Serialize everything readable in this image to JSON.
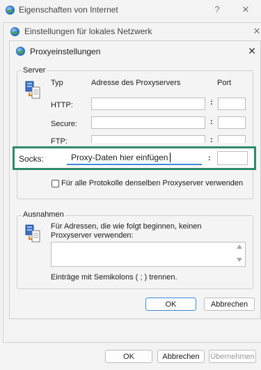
{
  "outer_window": {
    "title": "Eigenschaften von Internet",
    "help": "?",
    "close": "✕"
  },
  "lan_window": {
    "title": "Einstellungen für lokales Netzwerk",
    "close": "✕"
  },
  "proxy_dialog": {
    "title": "Proxyeinstellungen",
    "close": "✕",
    "server_group": {
      "legend": "Server",
      "col_type": "Typ",
      "col_address": "Adresse des Proxyservers",
      "col_port": "Port",
      "rows": [
        {
          "label": "HTTP:",
          "address": "",
          "port": ""
        },
        {
          "label": "Secure:",
          "address": "",
          "port": ""
        },
        {
          "label": "FTP:",
          "address": "",
          "port": ""
        }
      ],
      "socks": {
        "label": "Socks:",
        "address": "Proxy-Daten hier einfügen",
        "port": ""
      },
      "colon": ":",
      "same_proxy_label": "Für alle Protokolle denselben Proxyserver verwenden",
      "same_proxy_checked": false
    },
    "exceptions_group": {
      "legend": "Ausnahmen",
      "description": "Für Adressen, die wie folgt beginnen, keinen Proxyserver verwenden:",
      "value": "",
      "hint": "Einträge mit Semikolons ( ; ) trennen."
    },
    "ok_label": "OK",
    "cancel_label": "Abbrechen"
  },
  "bottom_bar": {
    "ok_label": "OK",
    "cancel_label": "Abbrechen",
    "apply_label": "Übernehmen"
  },
  "colors": {
    "highlight": "#2e8b6a",
    "primary_border": "#3c8ad9"
  }
}
